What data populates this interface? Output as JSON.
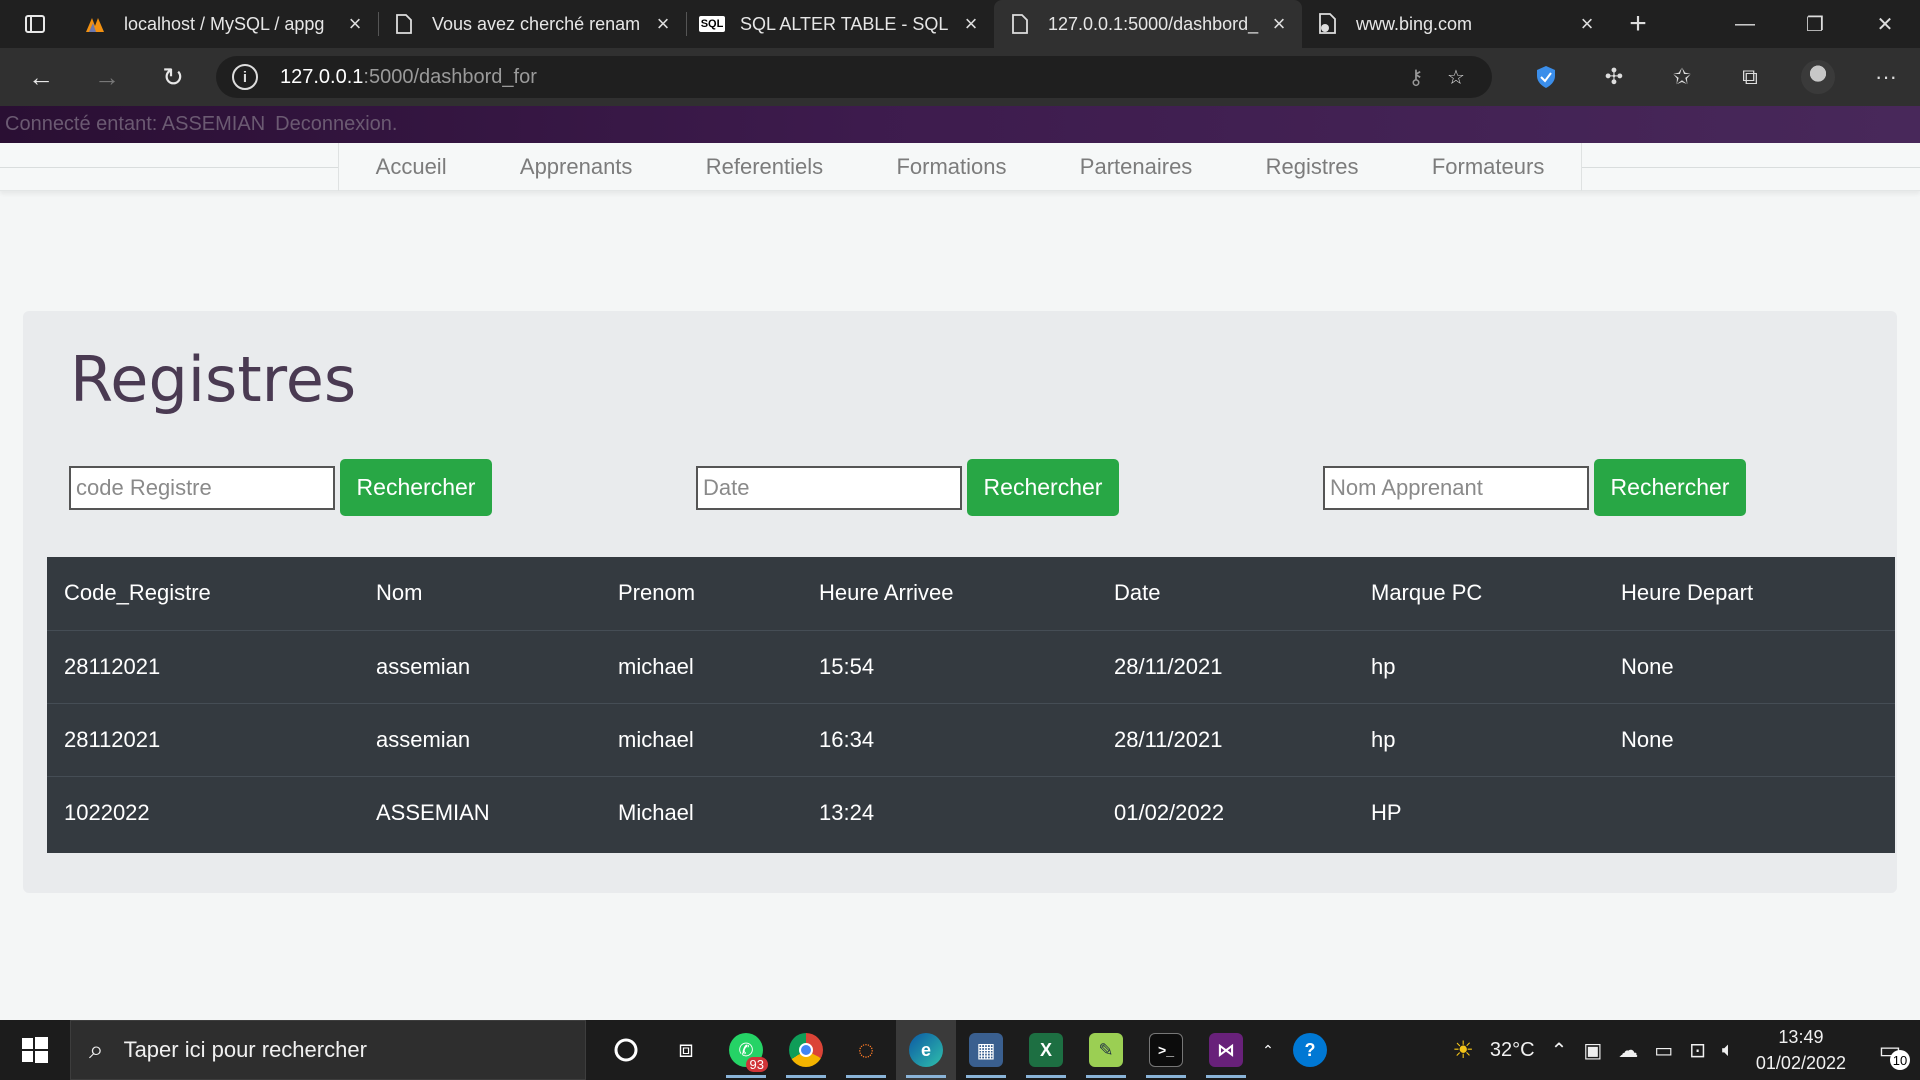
{
  "browser": {
    "tabs": [
      {
        "title": "localhost / MySQL / appg",
        "icon": "phpmyadmin-icon"
      },
      {
        "title": "Vous avez cherché renam",
        "icon": "page-icon"
      },
      {
        "title": "SQL ALTER TABLE - SQL",
        "icon": "sql-icon"
      },
      {
        "title": "127.0.0.1:5000/dashbord_",
        "icon": "page-icon"
      },
      {
        "title": "www.bing.com",
        "icon": "bing-page-icon"
      }
    ],
    "url_host": "127.0.0.1",
    "url_rest": ":5000/dashbord_for"
  },
  "page": {
    "user_text": "Connecté entant: ASSEMIAN",
    "logout_label": "Deconnexion.",
    "nav": [
      "Accueil",
      "Apprenants",
      "Referentiels",
      "Formations",
      "Partenaires",
      "Registres",
      "Formateurs"
    ],
    "title": "Registres",
    "search": [
      {
        "placeholder": "code Registre",
        "button": "Rechercher"
      },
      {
        "placeholder": "Date",
        "button": "Rechercher"
      },
      {
        "placeholder": "Nom Apprenant",
        "button": "Rechercher"
      }
    ],
    "table": {
      "headers": [
        "Code_Registre",
        "Nom",
        "Prenom",
        "Heure Arrivee",
        "Date",
        "Marque PC",
        "Heure Depart"
      ],
      "rows": [
        [
          "28112021",
          "assemian",
          "michael",
          "15:54",
          "28/11/2021",
          "hp",
          "None"
        ],
        [
          "28112021",
          "assemian",
          "michael",
          "16:34",
          "28/11/2021",
          "hp",
          "None"
        ],
        [
          "1022022",
          "ASSEMIAN",
          "Michael",
          "13:24",
          "01/02/2022",
          "HP",
          ""
        ]
      ]
    }
  },
  "taskbar": {
    "search_placeholder": "Taper ici pour rechercher",
    "whatsapp_badge": "93",
    "weather": "32°C",
    "time": "13:49",
    "date": "01/02/2022",
    "notifications": "10"
  },
  "colors": {
    "accent_green": "#28a745",
    "table_dark": "#343a40",
    "userbar_purple": "#3d1b4d"
  }
}
